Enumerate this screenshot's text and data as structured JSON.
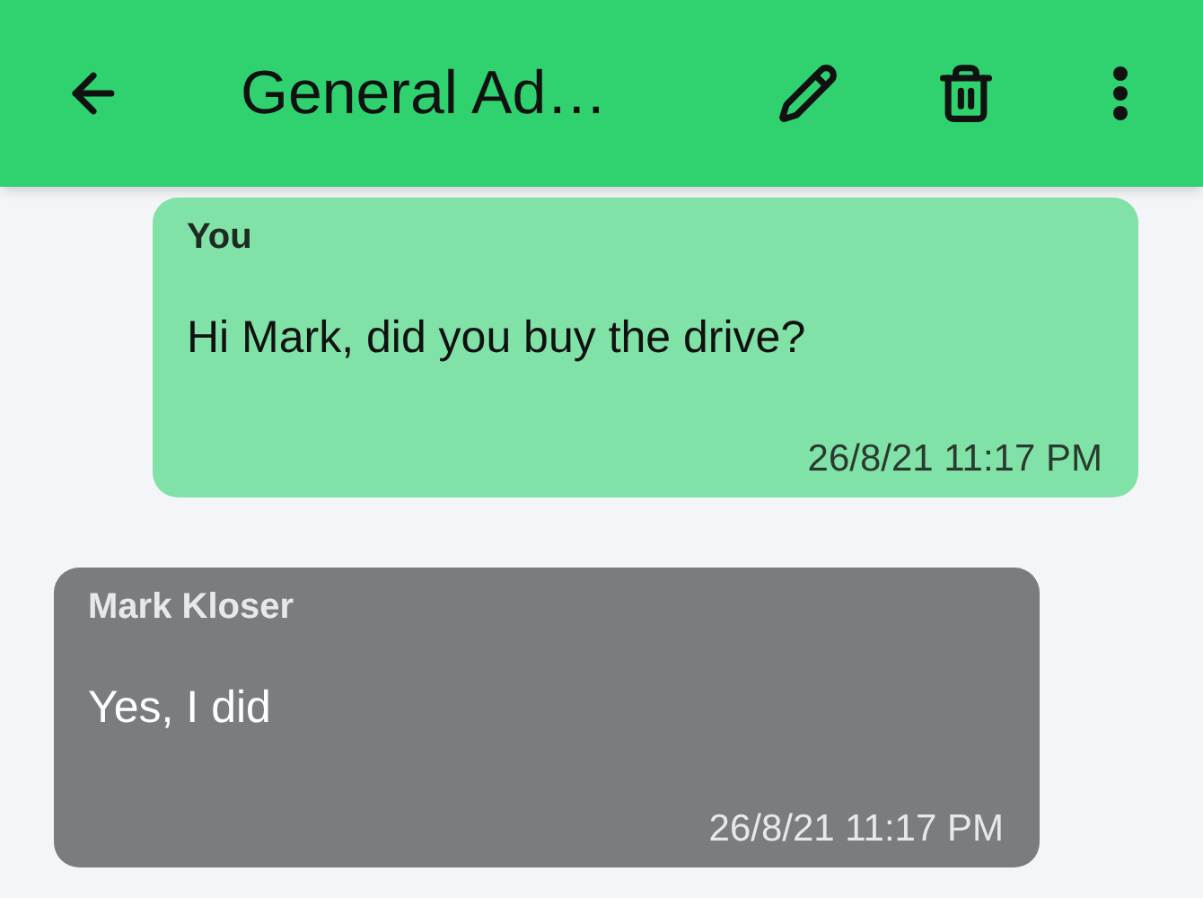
{
  "app_bar": {
    "title": "General Ad…"
  },
  "messages": [
    {
      "kind": "sent",
      "sender": "You",
      "text": "Hi Mark, did you buy the drive?",
      "time": "26/8/21 11:17 PM"
    },
    {
      "kind": "received",
      "sender": "Mark Kloser",
      "text": "Yes, I did",
      "time": "26/8/21 11:17 PM"
    }
  ]
}
